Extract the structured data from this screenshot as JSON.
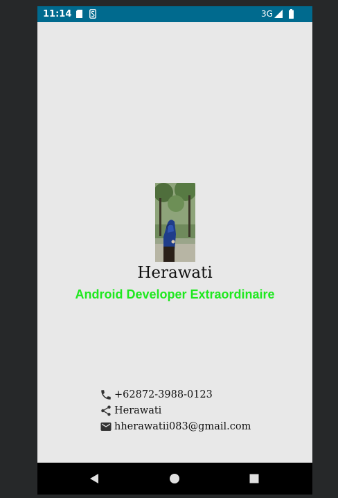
{
  "status_bar": {
    "time": "11:14",
    "network": "3G",
    "icons": [
      "sd-card-icon",
      "s-app-icon",
      "signal-icon",
      "battery-icon"
    ]
  },
  "profile": {
    "name": "Herawati",
    "title": "Android Developer Extraordinaire",
    "title_color": "#1ee81e"
  },
  "contacts": [
    {
      "icon": "phone-icon",
      "text": "+62872-3988-0123"
    },
    {
      "icon": "share-icon",
      "text": "Herawati"
    },
    {
      "icon": "email-icon",
      "text": "hherawatii083@gmail.com"
    }
  ],
  "navigation": {
    "buttons": [
      "back-icon",
      "home-icon",
      "recents-icon"
    ]
  },
  "colors": {
    "status_bar": "#006a8e",
    "background": "#e8e8e8",
    "nav_bar": "#000000"
  }
}
